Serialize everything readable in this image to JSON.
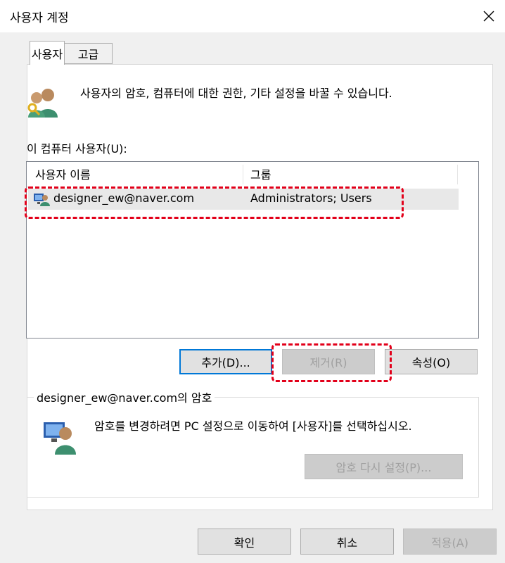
{
  "window": {
    "title": "사용자 계정"
  },
  "tabs": [
    {
      "label": "사용자"
    },
    {
      "label": "고급"
    }
  ],
  "intro": {
    "text": "사용자의 암호, 컴퓨터에 대한 권한, 기타 설정을 바꿀 수 있습니다."
  },
  "users_list": {
    "label": "이 컴퓨터 사용자(U):",
    "columns": [
      "사용자 이름",
      "그룹"
    ],
    "rows": [
      {
        "name": "designer_ew@naver.com",
        "group": "Administrators; Users"
      }
    ]
  },
  "actions": {
    "add": "추가(D)...",
    "remove": "제거(R)",
    "properties": "속성(O)"
  },
  "password_group": {
    "legend": "designer_ew@naver.com의 암호",
    "text": "암호를 변경하려면 PC 설정으로 이동하여 [사용자]를 선택하십시오.",
    "reset_button": "암호 다시 설정(P)..."
  },
  "footer": {
    "ok": "확인",
    "cancel": "취소",
    "apply": "적용(A)"
  },
  "colors": {
    "accent": "#0078d7",
    "highlight": "#e2001a",
    "panel": "#ffffff",
    "background": "#f0f0f0"
  },
  "icons": [
    "close-icon",
    "users-key-icon",
    "user-row-icon",
    "user-monitor-icon"
  ]
}
